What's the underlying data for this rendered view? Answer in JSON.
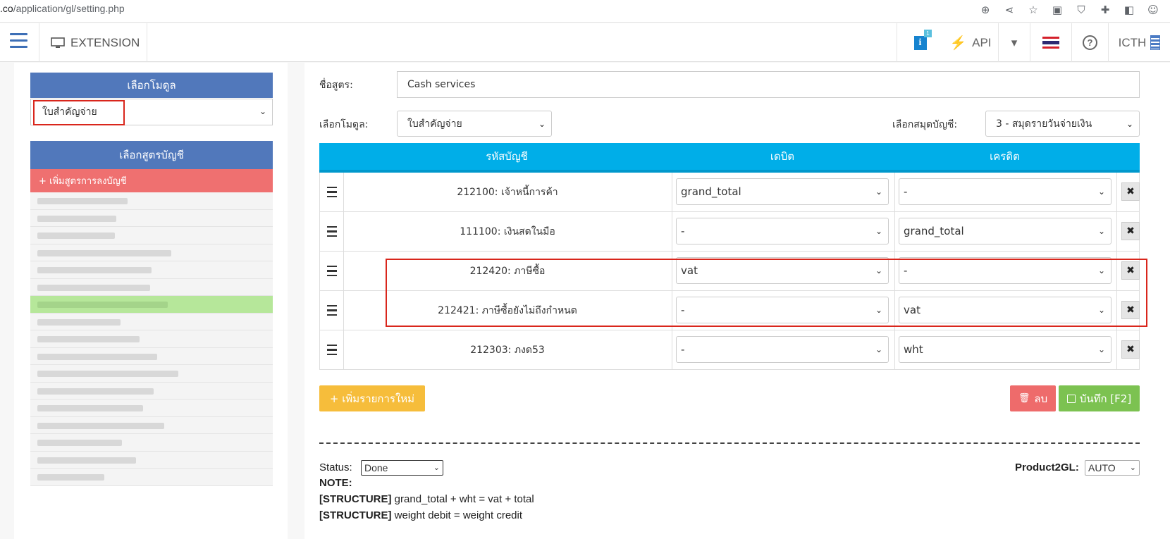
{
  "browser": {
    "url_host": ".co",
    "url_path": "/application/gl/setting.php"
  },
  "header": {
    "extension_label": "EXTENSION",
    "info_badge": "1",
    "api_label": "API",
    "company_label": "ICTH"
  },
  "sidebar": {
    "module_title": "เลือกโมดูล",
    "module_selected": "ใบสำคัญจ่าย",
    "formula_title": "เลือกสูตรบัญชี",
    "add_formula_label": "+ เพิ่มสูตรการลงบัญชี"
  },
  "form": {
    "name_label": "ชื่อสูตร:",
    "name_value": "Cash services",
    "module_label": "เลือกโมดูล:",
    "module_value": "ใบสำคัญจ่าย",
    "journal_label": "เลือกสมุดบัญชี:",
    "journal_value": "3 - สมุดรายวันจ่ายเงิน"
  },
  "table": {
    "headers": {
      "account": "รหัสบัญชี",
      "debit": "เดบิต",
      "credit": "เครดิต"
    },
    "rows": [
      {
        "account": "212100: เจ้าหนี้การค้า",
        "debit": "grand_total",
        "credit": "-"
      },
      {
        "account": "111100: เงินสดในมือ",
        "debit": "-",
        "credit": "grand_total"
      },
      {
        "account": "212420: ภาษีซื้อ",
        "debit": "vat",
        "credit": "-"
      },
      {
        "account": "212421: ภาษีซื้อยังไม่ถึงกำหนด",
        "debit": "-",
        "credit": "vat"
      },
      {
        "account": "212303: ภงด53",
        "debit": "-",
        "credit": "wht"
      }
    ]
  },
  "buttons": {
    "add_item": "+ เพิ่มรายการใหม่",
    "delete": "ลบ",
    "save": "บันทึก [F2]"
  },
  "footer": {
    "status_label": "Status:",
    "status_value": "Done",
    "product2gl_label": "Product2GL:",
    "product2gl_value": "AUTO",
    "note_label": "NOTE:",
    "structure_tag": "[STRUCTURE]",
    "structure_1": "grand_total + wht = vat + total",
    "structure_2": "weight debit = weight credit"
  },
  "colors": {
    "header_blue": "#5178bb",
    "table_head": "#00aee8",
    "add_formula_red": "#ef7070",
    "active_item": "#b6e79a",
    "highlight_box": "#d9261c"
  }
}
